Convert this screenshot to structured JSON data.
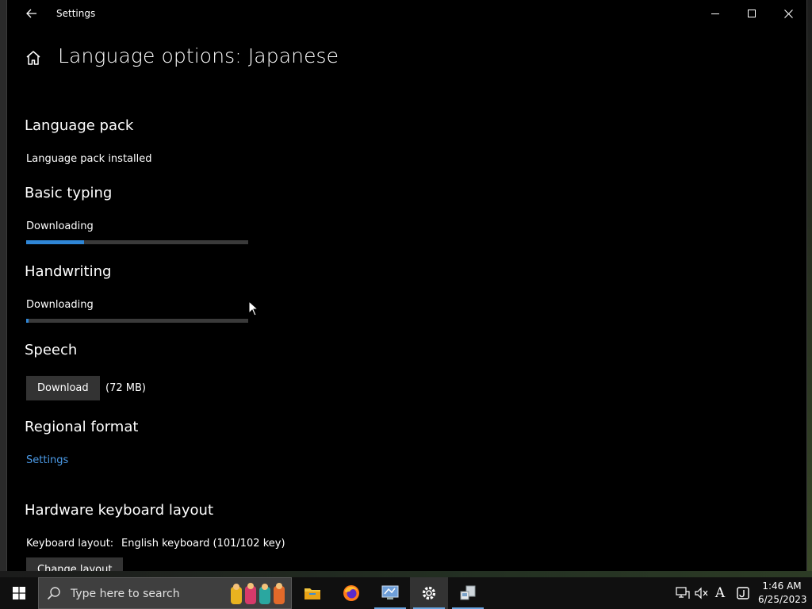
{
  "window": {
    "title": "Settings",
    "page_title": "Language options: Japanese"
  },
  "sections": {
    "language_pack": {
      "heading": "Language pack",
      "status": "Language pack installed"
    },
    "basic_typing": {
      "heading": "Basic typing",
      "status": "Downloading",
      "progress": 0.26
    },
    "handwriting": {
      "heading": "Handwriting",
      "status": "Downloading",
      "progress": 0.01
    },
    "speech": {
      "heading": "Speech",
      "button_label": "Download",
      "size": "(72 MB)"
    },
    "regional_format": {
      "heading": "Regional format",
      "link": "Settings"
    },
    "hardware_keyboard": {
      "heading": "Hardware keyboard layout",
      "label": "Keyboard layout:",
      "value": "English keyboard (101/102 key)",
      "button_label": "Change layout"
    }
  },
  "taskbar": {
    "search_placeholder": "Type here to search",
    "apps": [
      "file-explorer-icon",
      "firefox-icon",
      "control-panel-icon",
      "settings-icon",
      "network-app-icon"
    ],
    "active_app": "settings-icon",
    "ime_indicator": "A",
    "time": "1:46 AM",
    "date": "6/25/2023"
  },
  "colors": {
    "accent": "#2f86d6",
    "link": "#4c9be8",
    "window_bg": "#000000",
    "button_bg": "#333333"
  }
}
